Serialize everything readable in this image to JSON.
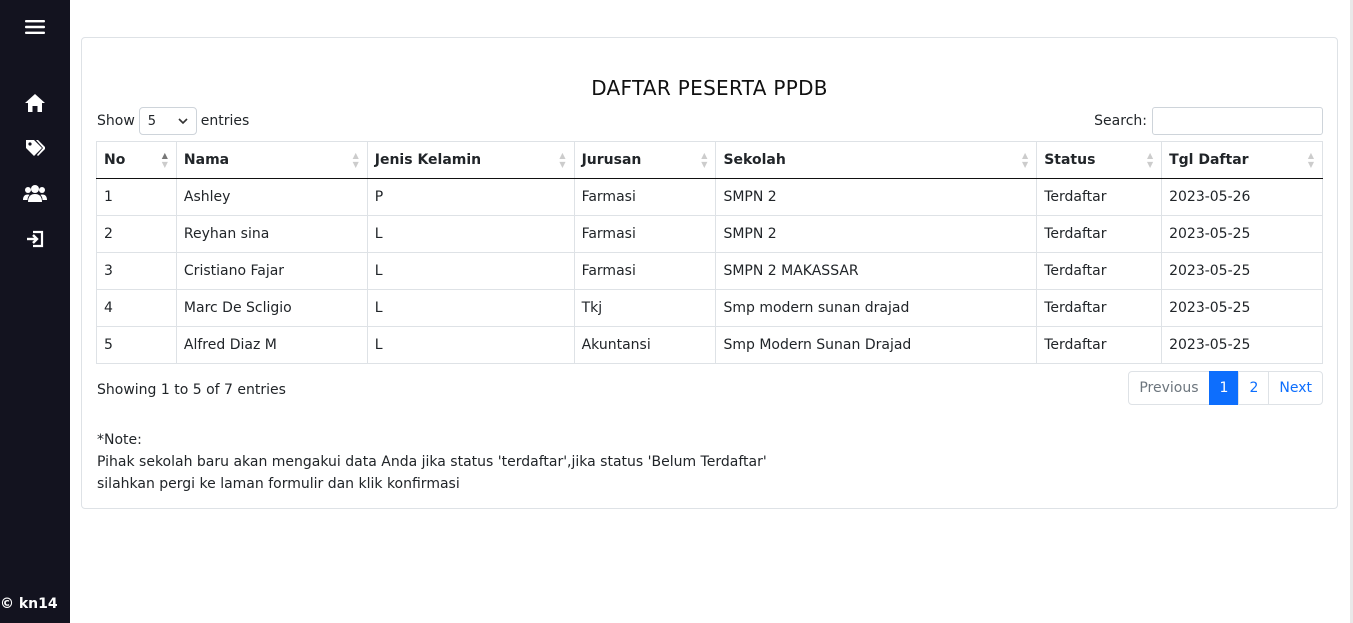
{
  "sidebar": {
    "icons": [
      "menu-icon",
      "home-icon",
      "tags-icon",
      "users-icon",
      "logout-icon"
    ],
    "footer": "© kn14"
  },
  "page": {
    "title": "DAFTAR PESERTA PPDB",
    "length": {
      "show_label": "Show",
      "value": "5",
      "entries_label": "entries"
    },
    "search": {
      "label": "Search:",
      "value": "",
      "placeholder": ""
    }
  },
  "table": {
    "columns": [
      "No",
      "Nama",
      "Jenis Kelamin",
      "Jurusan",
      "Sekolah",
      "Status",
      "Tgl Daftar"
    ],
    "rows": [
      [
        "1",
        "Ashley",
        "P",
        "Farmasi",
        "SMPN 2",
        "Terdaftar",
        "2023-05-26"
      ],
      [
        "2",
        "Reyhan sina",
        "L",
        "Farmasi",
        "SMPN 2",
        "Terdaftar",
        "2023-05-25"
      ],
      [
        "3",
        "Cristiano Fajar",
        "L",
        "Farmasi",
        "SMPN 2 MAKASSAR",
        "Terdaftar",
        "2023-05-25"
      ],
      [
        "4",
        "Marc De Scligio",
        "L",
        "Tkj",
        "Smp modern sunan drajad",
        "Terdaftar",
        "2023-05-25"
      ],
      [
        "5",
        "Alfred Diaz M",
        "L",
        "Akuntansi",
        "Smp Modern Sunan Drajad",
        "Terdaftar",
        "2023-05-25"
      ]
    ]
  },
  "info": "Showing 1 to 5 of 7 entries",
  "pagination": {
    "prev": "Previous",
    "pages": [
      "1",
      "2"
    ],
    "active": "1",
    "next": "Next"
  },
  "note": {
    "title": "*Note:",
    "line1": "Pihak sekolah baru akan mengakui data Anda jika status 'terdaftar',jika status 'Belum Terdaftar'",
    "line2": "silahkan pergi ke laman formulir dan klik konfirmasi"
  },
  "colors": {
    "sidebar": "#13131f",
    "accent": "#0d6efd"
  }
}
